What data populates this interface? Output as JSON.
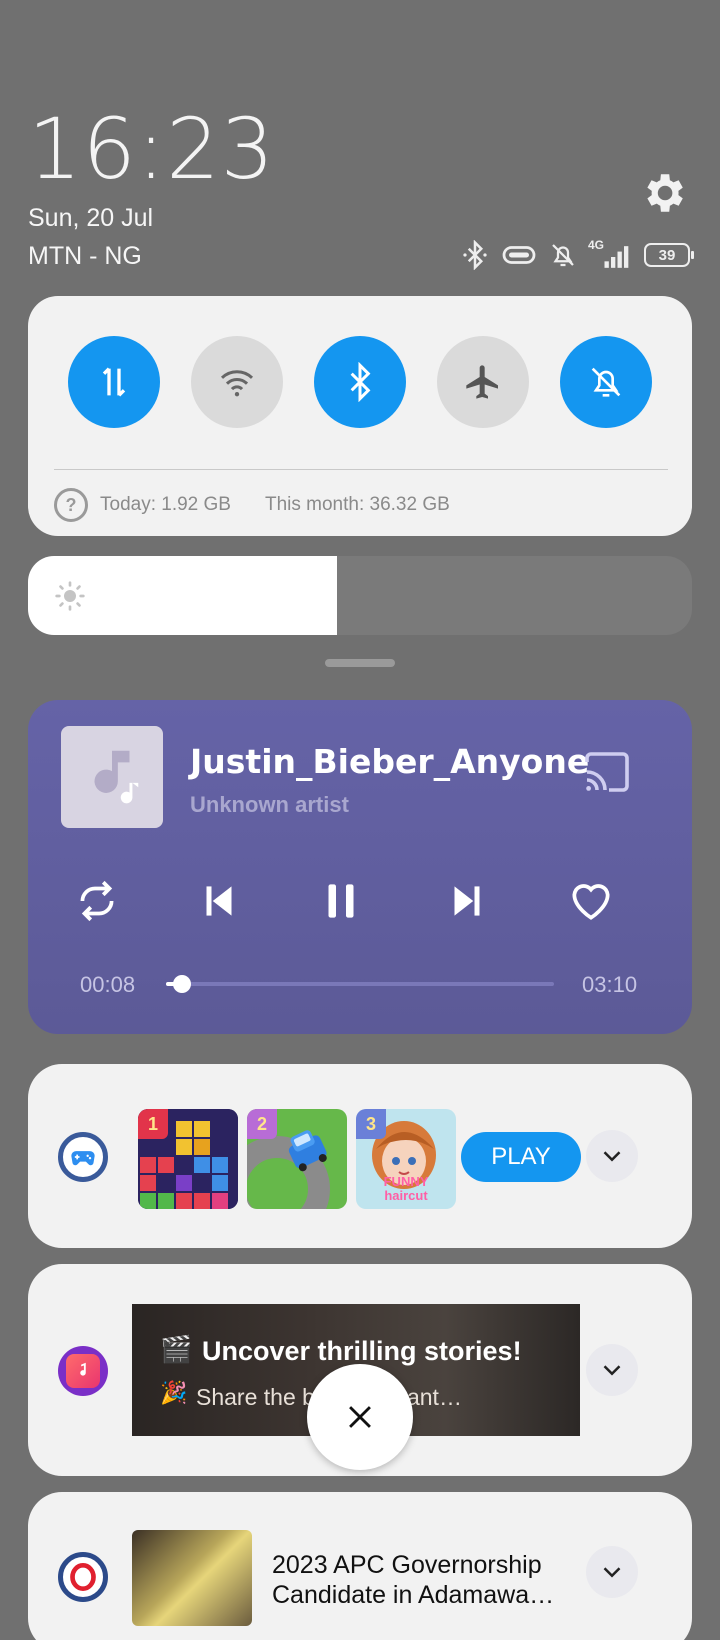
{
  "header": {
    "time": "16:23",
    "date": "Sun, 20 Jul",
    "carrier": "MTN - NG",
    "network_label": "4G",
    "battery_level": "39"
  },
  "quick_settings": {
    "toggles": [
      {
        "name": "mobile-data",
        "icon": "data-transfer-icon",
        "on": true
      },
      {
        "name": "wifi",
        "icon": "wifi-icon",
        "on": false
      },
      {
        "name": "bluetooth",
        "icon": "bluetooth-icon",
        "on": true
      },
      {
        "name": "airplane-mode",
        "icon": "airplane-icon",
        "on": false
      },
      {
        "name": "silent",
        "icon": "bell-off-icon",
        "on": true
      }
    ],
    "data_today": "Today: 1.92 GB",
    "data_month": "This month: 36.32 GB"
  },
  "brightness": {
    "level": 0.465
  },
  "media": {
    "title": "Justin_Bieber_Anyone",
    "artist": "Unknown artist",
    "elapsed": "00:08",
    "total": "03:10",
    "progress": 0.042,
    "accent": "#6563a7"
  },
  "notifications": {
    "games": {
      "ranks": [
        "1",
        "2",
        "3"
      ],
      "thumb_label": "FUNNY haircut",
      "play_label": "PLAY"
    },
    "music": {
      "title": "Uncover thrilling stories!",
      "text": "Share the b      ents instant…"
    },
    "opera": {
      "title": "2023 APC Governorship Candidate in Adamawa…"
    }
  },
  "colors": {
    "toggle_on": "#1496f0",
    "toggle_off": "#dadada",
    "panel": "#f2f2f2"
  }
}
